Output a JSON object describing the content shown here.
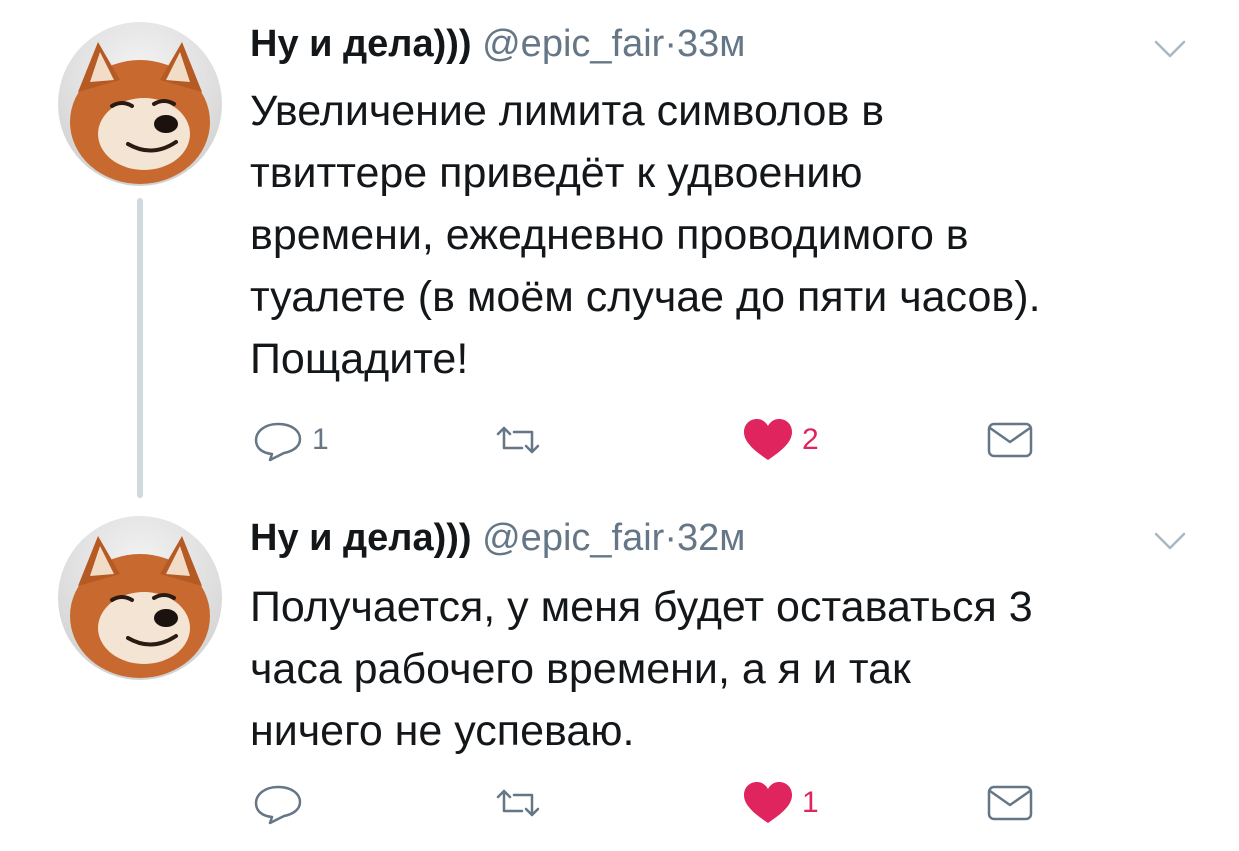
{
  "tweets": [
    {
      "author_name": "Ну и дела)))",
      "handle": "@epic_fair",
      "separator": "·",
      "time": "33м",
      "text": "Увеличение лимита символов в\nтвиттере приведёт к удвоению\nвремени, ежедневно проводимого в\nтуалете (в моём случае до пяти часов).\nПощадите!",
      "reply_count": "1",
      "retweet_count": "",
      "like_count": "2",
      "liked": true
    },
    {
      "author_name": "Ну и дела)))",
      "handle": "@epic_fair",
      "separator": "·",
      "time": "32м",
      "text": "Получается, у меня будет оставаться 3\nчаса рабочего времени, а я и так\nничего не успеваю.",
      "reply_count": "",
      "retweet_count": "",
      "like_count": "1",
      "liked": true
    }
  ],
  "colors": {
    "like_active": "#e0245e",
    "icon_gray": "#657786",
    "thread_line": "#cfd9de",
    "avatar_fur": "#c8692f"
  },
  "icons": {
    "reply": "reply-bubble-icon",
    "retweet": "retweet-icon",
    "like": "heart-icon",
    "dm": "envelope-icon",
    "more": "chevron-down-icon"
  }
}
